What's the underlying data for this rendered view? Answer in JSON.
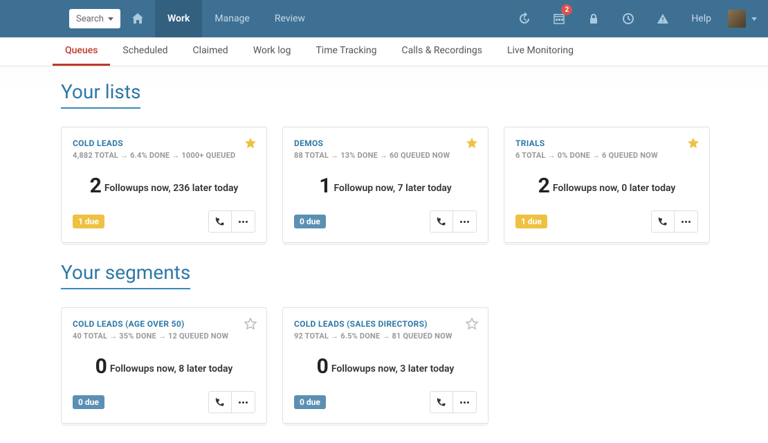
{
  "topnav": {
    "search_label": "Search",
    "links": [
      "Work",
      "Manage",
      "Review"
    ],
    "active_link": "Work",
    "badge_count": "2",
    "help_label": "Help"
  },
  "subnav": {
    "tabs": [
      "Queues",
      "Scheduled",
      "Claimed",
      "Work log",
      "Time Tracking",
      "Calls & Recordings",
      "Live Monitoring"
    ],
    "active_tab": "Queues"
  },
  "sections": {
    "lists_title": "Your lists",
    "segments_title": "Your segments"
  },
  "lists": [
    {
      "title": "COLD LEADS",
      "stats": "4,882 TOTAL → 6.4% DONE → 1000+ QUEUED",
      "count": "2",
      "text": "Followups now, 236 later today",
      "due": "1 due",
      "due_color": "yellow",
      "starred": true
    },
    {
      "title": "DEMOS",
      "stats": "88 TOTAL → 13% DONE → 60 QUEUED NOW",
      "count": "1",
      "text": "Followup now, 7 later today",
      "due": "0 due",
      "due_color": "blue",
      "starred": true
    },
    {
      "title": "TRIALS",
      "stats": "6 TOTAL → 0% DONE → 6 QUEUED NOW",
      "count": "2",
      "text": "Followups now, 0 later today",
      "due": "1 due",
      "due_color": "yellow",
      "starred": true
    }
  ],
  "segments": [
    {
      "title": "COLD LEADS (AGE OVER 50)",
      "stats": "40 TOTAL → 35% DONE → 12 QUEUED NOW",
      "count": "0",
      "text": "Followups now, 8 later today",
      "due": "0 due",
      "due_color": "blue",
      "starred": false
    },
    {
      "title": "COLD LEADS (SALES DIRECTORS)",
      "stats": "92 TOTAL → 6.5% DONE → 81 QUEUED NOW",
      "count": "0",
      "text": "Followups now, 3 later today",
      "due": "0 due",
      "due_color": "blue",
      "starred": false
    }
  ]
}
